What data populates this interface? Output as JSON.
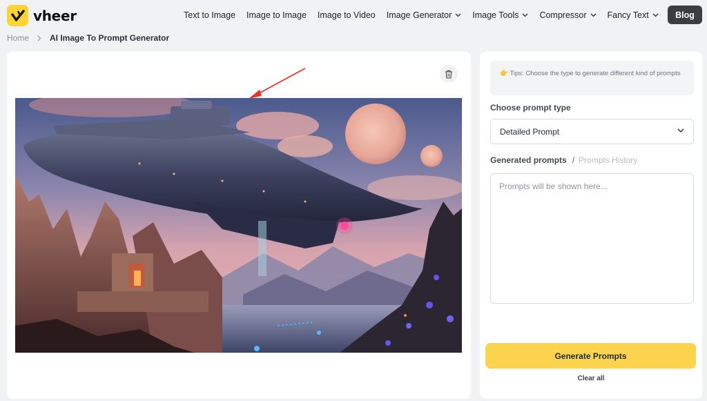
{
  "brand": {
    "name": "vheer",
    "accent": "#fcd535"
  },
  "nav": {
    "items": [
      {
        "label": "Text to Image",
        "has_dropdown": false
      },
      {
        "label": "Image to Image",
        "has_dropdown": false
      },
      {
        "label": "Image to Video",
        "has_dropdown": false
      },
      {
        "label": "Image Generator",
        "has_dropdown": true
      },
      {
        "label": "Image Tools",
        "has_dropdown": true
      },
      {
        "label": "Compressor",
        "has_dropdown": true
      },
      {
        "label": "Fancy Text",
        "has_dropdown": true
      }
    ],
    "blog_label": "Blog"
  },
  "breadcrumb": {
    "home": "Home",
    "current": "AI Image To Prompt Generator"
  },
  "upload": {
    "delete_icon": "trash-icon",
    "image_alt": "Spaceship hovering over rocky canyon at sunset with two moons"
  },
  "sidebar": {
    "tips": "Tips: Choose the type to generate different kind of prompts",
    "tips_icon": "pointing-hand-icon",
    "prompt_type_label": "Choose prompt type",
    "prompt_type_value": "Detailed Prompt",
    "generated_tab": "Generated prompts",
    "separator": "/",
    "history_tab": "Prompts History",
    "prompt_placeholder": "Prompts will be shown here...",
    "generate_label": "Generate Prompts",
    "clear_label": "Clear all",
    "generate_color": "#fcd34d"
  }
}
